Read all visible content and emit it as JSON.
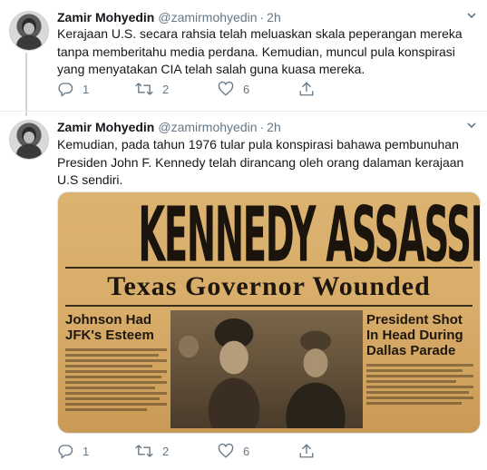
{
  "tweets": [
    {
      "author_name": "Zamir Mohyedin",
      "handle": "@zamirmohyedin",
      "separator": "·",
      "time": "2h",
      "text": "Kerajaan U.S. secara rahsia telah meluaskan skala peperangan mereka tanpa memberitahu media perdana. Kemudian, muncul pula konspirasi yang menyatakan CIA telah salah guna kuasa mereka.",
      "reply_count": "1",
      "retweet_count": "2",
      "like_count": "6"
    },
    {
      "author_name": "Zamir Mohyedin",
      "handle": "@zamirmohyedin",
      "separator": "·",
      "time": "2h",
      "text": "Kemudian, pada tahun 1976 tular pula konspirasi bahawa pembunuhan Presiden John F. Kennedy telah dirancang oleh orang dalaman kerajaan U.S sendiri.",
      "reply_count": "1",
      "retweet_count": "2",
      "like_count": "6",
      "image": {
        "banner": "KENNEDY ASSASSINATED",
        "subhead": "Texas Governor Wounded",
        "left_column_head": "Johnson Had JFK's Esteem",
        "right_column_head": "President Shot In Head During Dallas Parade"
      }
    }
  ],
  "icons": {
    "reply": "reply-icon",
    "retweet": "retweet-icon",
    "like": "heart-icon",
    "share": "share-icon",
    "menu": "chevron-down-icon"
  },
  "colors": {
    "text_primary": "#14171a",
    "text_secondary": "#657786",
    "divider": "#e6ecf0",
    "thread_line": "#ccd6dd"
  }
}
